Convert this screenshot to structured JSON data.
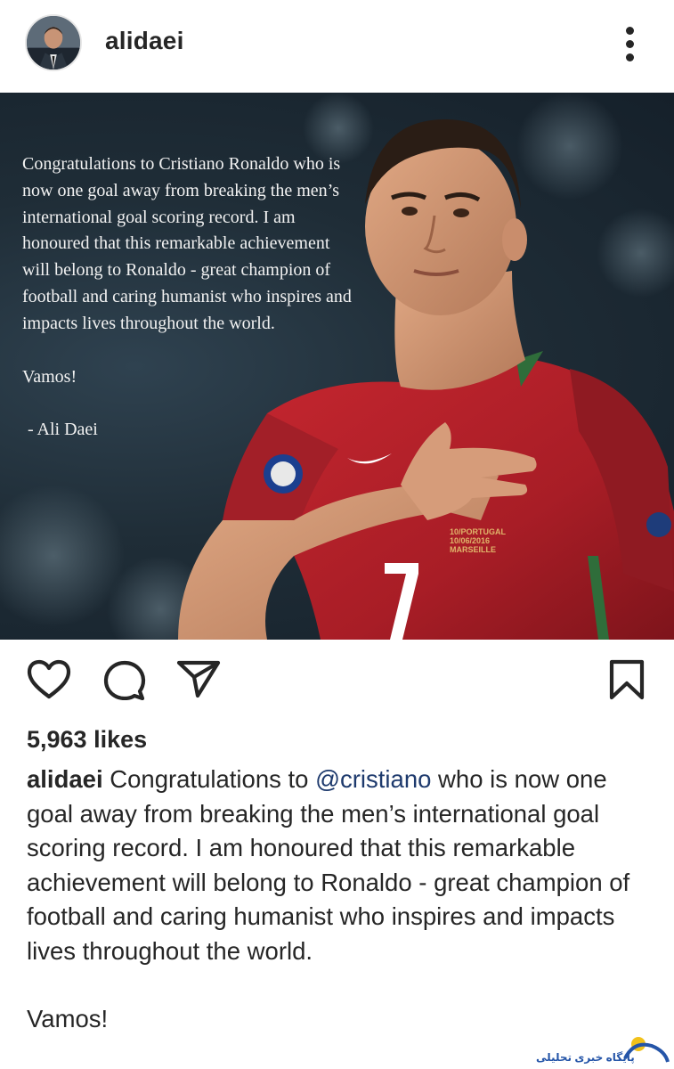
{
  "header": {
    "username": "alidaei",
    "avatar_icon": "avatar-photo",
    "more_icon": "more-vertical-icon"
  },
  "post_image": {
    "quote_paragraphs": [
      "Congratulations to Cristiano Ronaldo who is now one goal away from breaking the men’s international goal scoring record. I am honoured that this remarkable achievement will belong to Ronaldo - great champion of football and caring humanist who inspires and impacts lives throughout the world.",
      "Vamos!",
      "- Ali Daei"
    ],
    "shirt_number": "7",
    "shirt_text_1": "10/PORTUGAL",
    "shirt_text_2": "10/06/2016",
    "shirt_text_3": "MARSEILLE"
  },
  "actions": {
    "like_icon": "heart-icon",
    "comment_icon": "comment-icon",
    "share_icon": "send-icon",
    "save_icon": "bookmark-icon"
  },
  "likes": "5,963 likes",
  "caption": {
    "username": "alidaei",
    "text_before_mention": " Congratulations to ",
    "mention": "@cristiano",
    "text_after_mention": " who is now one goal away from breaking the men’s international goal scoring record. I am honoured that this remarkable achievement will belong to Ronaldo - great champion of football and caring humanist who inspires and impacts lives throughout the world.",
    "closing": "Vamos!"
  },
  "watermark": {
    "text": "پایگاه خبری تحلیلی"
  },
  "colors": {
    "text": "#262626",
    "mention": "#1e3a6d",
    "shirt_red": "#b3202a"
  }
}
